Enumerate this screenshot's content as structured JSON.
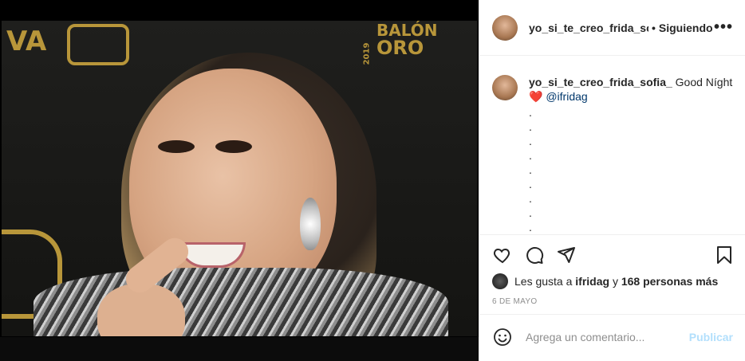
{
  "post": {
    "image_alt_icon": "photo-of-woman",
    "background_logos": {
      "left_text": "VA",
      "right_line1": "BALÓN",
      "right_line2": "ORO",
      "right_year": "2019"
    }
  },
  "header": {
    "username": "yo_si_te_creo_frida_sofia_",
    "separator": "•",
    "follow_label": "Siguiendo",
    "more_icon": "more-horizontal-icon"
  },
  "caption": {
    "username": "yo_si_te_creo_frida_sofia_",
    "text": "Good Níght",
    "emoji": "❤️",
    "mention": "@ifridag",
    "dots": [
      ".",
      ".",
      ".",
      ".",
      ".",
      ".",
      ".",
      ".",
      "."
    ]
  },
  "actions": {
    "like_icon": "heart-icon",
    "comment_icon": "comment-icon",
    "share_icon": "share-icon",
    "save_icon": "bookmark-icon"
  },
  "likes": {
    "prefix": "Les gusta a",
    "user": "ifridag",
    "connector": "y",
    "others": "168 personas más"
  },
  "date": "6 DE MAYO",
  "comment_box": {
    "emoji_icon": "smiley-icon",
    "placeholder": "Agrega un comentario...",
    "publish_label": "Publicar"
  },
  "colors": {
    "mention": "#00376b",
    "publish_disabled": "#b2dffc",
    "heart_emoji": "#e0245e",
    "gold_logo": "#b8963a"
  }
}
